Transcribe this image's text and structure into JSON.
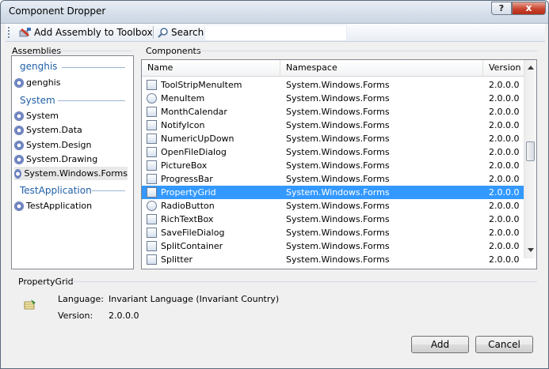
{
  "window": {
    "title": "Component Dropper"
  },
  "titlebar": {
    "help_glyph": "?",
    "close_glyph": "x"
  },
  "toolbar": {
    "add_assembly_label": "Add Assembly to Toolbox",
    "search_label": "Search",
    "search_value": ""
  },
  "assemblies": {
    "title": "Assemblies",
    "groups": [
      {
        "name": "genghis",
        "items": [
          "genghis"
        ]
      },
      {
        "name": "System",
        "items": [
          "System",
          "System.Data",
          "System.Design",
          "System.Drawing",
          "System.Windows.Forms"
        ]
      },
      {
        "name": "TestApplication",
        "items": [
          "TestApplication"
        ]
      }
    ],
    "selected": "System.Windows.Forms"
  },
  "components": {
    "title": "Components",
    "columns": [
      "Name",
      "Namespace",
      "Version"
    ],
    "rows": [
      [
        "ToolStripMenuItem",
        "System.Windows.Forms",
        "2.0.0.0"
      ],
      [
        "MenuItem",
        "System.Windows.Forms",
        "2.0.0.0"
      ],
      [
        "MonthCalendar",
        "System.Windows.Forms",
        "2.0.0.0"
      ],
      [
        "NotifyIcon",
        "System.Windows.Forms",
        "2.0.0.0"
      ],
      [
        "NumericUpDown",
        "System.Windows.Forms",
        "2.0.0.0"
      ],
      [
        "OpenFileDialog",
        "System.Windows.Forms",
        "2.0.0.0"
      ],
      [
        "PictureBox",
        "System.Windows.Forms",
        "2.0.0.0"
      ],
      [
        "ProgressBar",
        "System.Windows.Forms",
        "2.0.0.0"
      ],
      [
        "PropertyGrid",
        "System.Windows.Forms",
        "2.0.0.0"
      ],
      [
        "RadioButton",
        "System.Windows.Forms",
        "2.0.0.0"
      ],
      [
        "RichTextBox",
        "System.Windows.Forms",
        "2.0.0.0"
      ],
      [
        "SaveFileDialog",
        "System.Windows.Forms",
        "2.0.0.0"
      ],
      [
        "SplitContainer",
        "System.Windows.Forms",
        "2.0.0.0"
      ],
      [
        "Splitter",
        "System.Windows.Forms",
        "2.0.0.0"
      ]
    ],
    "selected": "PropertyGrid",
    "icons": [
      "toolstrip-menu-item-icon",
      "gear-icon",
      "calendar-icon",
      "notify-icon-icon",
      "numeric-updown-icon",
      "open-file-dialog-icon",
      "picture-box-icon",
      "progress-bar-icon",
      "property-grid-icon",
      "radio-button-icon",
      "rich-text-box-icon",
      "save-file-dialog-icon",
      "split-container-icon",
      "splitter-icon"
    ]
  },
  "details": {
    "title": "PropertyGrid",
    "language_label": "Language:",
    "language_value": "Invariant Language (Invariant Country)",
    "version_label": "Version:",
    "version_value": "2.0.0.0"
  },
  "buttons": {
    "add": "Add",
    "cancel": "Cancel"
  },
  "colors": {
    "selection": "#3399ff",
    "group_heading": "#1f5fa6"
  }
}
